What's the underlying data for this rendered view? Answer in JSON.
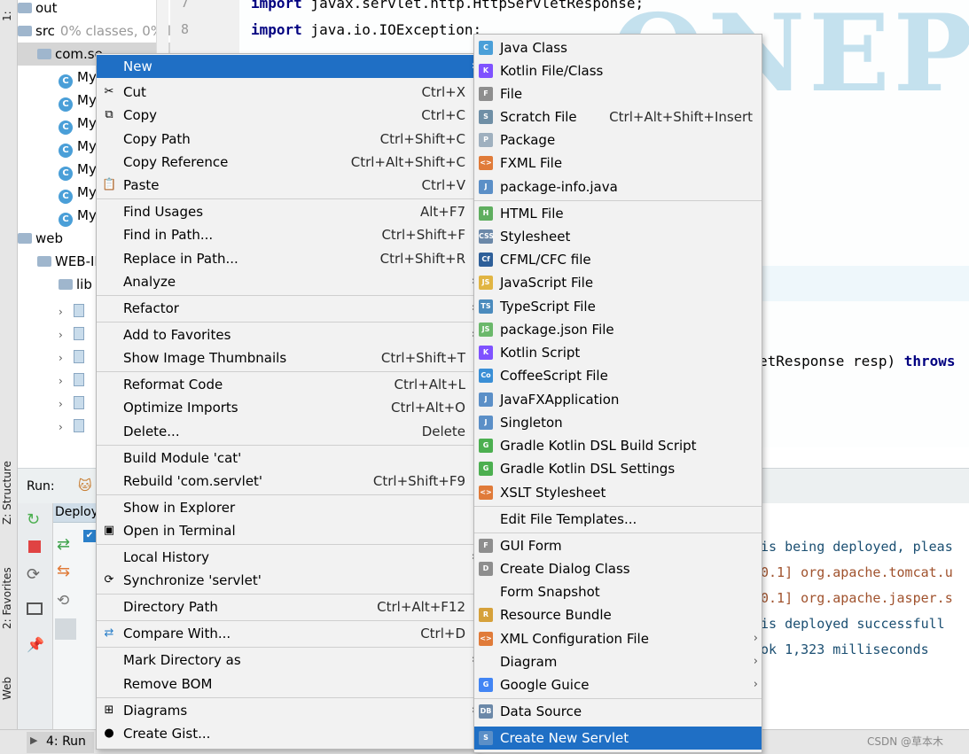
{
  "left_strip": {
    "project_tab": "1:",
    "structure_tab": "Z: Structure",
    "favorites_tab": "2: Favorites",
    "web_tab": "Web"
  },
  "tree": {
    "rows": [
      {
        "label": "out",
        "kind": "folder"
      },
      {
        "label": "src",
        "extra": "0% classes, 0% lir",
        "kind": "folder"
      },
      {
        "label": "com.se",
        "extra": "",
        "kind": "package"
      },
      {
        "label": "My",
        "kind": "class"
      },
      {
        "label": "My",
        "kind": "class"
      },
      {
        "label": "My",
        "kind": "class"
      },
      {
        "label": "My",
        "kind": "class"
      },
      {
        "label": "My",
        "kind": "class"
      },
      {
        "label": "My",
        "kind": "class"
      },
      {
        "label": "My",
        "kind": "class"
      },
      {
        "label": "web",
        "kind": "folder"
      },
      {
        "label": "WEB-IN",
        "kind": "folder"
      },
      {
        "label": "lib",
        "kind": "folder"
      }
    ],
    "class_badge": "C"
  },
  "editor": {
    "line_numbers": [
      "7",
      "8"
    ],
    "lines": [
      {
        "kw": "import",
        "rest": " javax.servlet.http.HttpServletResponse;"
      },
      {
        "kw": "import",
        "rest": " java.io.IOException;"
      }
    ],
    "fragment_rest": "etResponse resp) ",
    "fragment_kw": "throws",
    "watermark": "ONEPIECE"
  },
  "run_panel": {
    "run_label": "Run:",
    "deploy_tab": "Deploy",
    "console_lines": [
      {
        "text": "is being deployed, pleas",
        "style": "plain"
      },
      {
        "text": "0.1] org.apache.tomcat.u",
        "style": "orange"
      },
      {
        "text": "0.1] org.apache.jasper.s",
        "style": "orange"
      },
      {
        "text": "is deployed successfull",
        "style": "plain"
      },
      {
        "text": "ok 1,323 milliseconds",
        "style": "plain"
      }
    ]
  },
  "bottom_bar": {
    "run_tab": "4: Run",
    "credit": "CSDN @草本木"
  },
  "context_menu": {
    "items": [
      {
        "label": "New",
        "shortcut": "",
        "icon": "",
        "submenu": true,
        "highlight": true
      },
      {
        "label": "Cut",
        "shortcut": "Ctrl+X",
        "icon": "scissors-icon",
        "submenu": false
      },
      {
        "label": "Copy",
        "shortcut": "Ctrl+C",
        "icon": "copy-icon",
        "submenu": false
      },
      {
        "label": "Copy Path",
        "shortcut": "Ctrl+Shift+C",
        "icon": "",
        "submenu": false
      },
      {
        "label": "Copy Reference",
        "shortcut": "Ctrl+Alt+Shift+C",
        "icon": "",
        "submenu": false
      },
      {
        "label": "Paste",
        "shortcut": "Ctrl+V",
        "icon": "paste-icon",
        "submenu": false
      },
      {
        "label": "Find Usages",
        "shortcut": "Alt+F7",
        "icon": "",
        "submenu": false
      },
      {
        "label": "Find in Path...",
        "shortcut": "Ctrl+Shift+F",
        "icon": "",
        "submenu": false
      },
      {
        "label": "Replace in Path...",
        "shortcut": "Ctrl+Shift+R",
        "icon": "",
        "submenu": false
      },
      {
        "label": "Analyze",
        "shortcut": "",
        "icon": "",
        "submenu": true
      },
      {
        "label": "Refactor",
        "shortcut": "",
        "icon": "",
        "submenu": true
      },
      {
        "label": "Add to Favorites",
        "shortcut": "",
        "icon": "",
        "submenu": true
      },
      {
        "label": "Show Image Thumbnails",
        "shortcut": "Ctrl+Shift+T",
        "icon": "",
        "submenu": false
      },
      {
        "label": "Reformat Code",
        "shortcut": "Ctrl+Alt+L",
        "icon": "",
        "submenu": false
      },
      {
        "label": "Optimize Imports",
        "shortcut": "Ctrl+Alt+O",
        "icon": "",
        "submenu": false
      },
      {
        "label": "Delete...",
        "shortcut": "Delete",
        "icon": "",
        "submenu": false
      },
      {
        "label": "Build Module 'cat'",
        "shortcut": "",
        "icon": "",
        "submenu": false
      },
      {
        "label": "Rebuild 'com.servlet'",
        "shortcut": "Ctrl+Shift+F9",
        "icon": "",
        "submenu": false
      },
      {
        "label": "Show in Explorer",
        "shortcut": "",
        "icon": "",
        "submenu": false
      },
      {
        "label": "Open in Terminal",
        "shortcut": "",
        "icon": "terminal-icon",
        "submenu": false
      },
      {
        "label": "Local History",
        "shortcut": "",
        "icon": "",
        "submenu": true
      },
      {
        "label": "Synchronize 'servlet'",
        "shortcut": "",
        "icon": "sync-icon",
        "submenu": false
      },
      {
        "label": "Directory Path",
        "shortcut": "Ctrl+Alt+F12",
        "icon": "",
        "submenu": false
      },
      {
        "label": "Compare With...",
        "shortcut": "Ctrl+D",
        "icon": "compare-icon",
        "submenu": false
      },
      {
        "label": "Mark Directory as",
        "shortcut": "",
        "icon": "",
        "submenu": true
      },
      {
        "label": "Remove BOM",
        "shortcut": "",
        "icon": "",
        "submenu": false
      },
      {
        "label": "Diagrams",
        "shortcut": "",
        "icon": "diagram-icon",
        "submenu": true
      },
      {
        "label": "Create Gist...",
        "shortcut": "",
        "icon": "github-icon",
        "submenu": false
      }
    ]
  },
  "new_submenu": {
    "items": [
      {
        "label": "Java Class",
        "shortcut": "",
        "icon": "C",
        "color": "#4a9fd8",
        "submenu": false
      },
      {
        "label": "Kotlin File/Class",
        "shortcut": "",
        "icon": "K",
        "color": "#7f52ff",
        "submenu": false
      },
      {
        "label": "File",
        "shortcut": "",
        "icon": "F",
        "color": "#8e8e8e",
        "submenu": false
      },
      {
        "label": "Scratch File",
        "shortcut": "Ctrl+Alt+Shift+Insert",
        "icon": "S",
        "color": "#6f8fa6",
        "submenu": false
      },
      {
        "label": "Package",
        "shortcut": "",
        "icon": "P",
        "color": "#9fb0bf",
        "submenu": false
      },
      {
        "label": "FXML File",
        "shortcut": "",
        "icon": "<>",
        "color": "#e07b39",
        "submenu": false
      },
      {
        "label": "package-info.java",
        "shortcut": "",
        "icon": "J",
        "color": "#5b8fc7",
        "submenu": false
      },
      {
        "label": "HTML File",
        "shortcut": "",
        "icon": "H",
        "color": "#5fae5f",
        "submenu": false
      },
      {
        "label": "Stylesheet",
        "shortcut": "",
        "icon": "CSS",
        "color": "#6b88a8",
        "submenu": false
      },
      {
        "label": "CFML/CFC file",
        "shortcut": "",
        "icon": "Cf",
        "color": "#2e5f99",
        "submenu": false
      },
      {
        "label": "JavaScript File",
        "shortcut": "",
        "icon": "JS",
        "color": "#e1b543",
        "submenu": false
      },
      {
        "label": "TypeScript File",
        "shortcut": "",
        "icon": "TS",
        "color": "#4b8bbd",
        "submenu": false
      },
      {
        "label": "package.json File",
        "shortcut": "",
        "icon": "JS",
        "color": "#6bb86b",
        "submenu": false
      },
      {
        "label": "Kotlin Script",
        "shortcut": "",
        "icon": "K",
        "color": "#7f52ff",
        "submenu": false
      },
      {
        "label": "CoffeeScript File",
        "shortcut": "",
        "icon": "Co",
        "color": "#3a8fd6",
        "submenu": false
      },
      {
        "label": "JavaFXApplication",
        "shortcut": "",
        "icon": "J",
        "color": "#5b8fc7",
        "submenu": false
      },
      {
        "label": "Singleton",
        "shortcut": "",
        "icon": "J",
        "color": "#5b8fc7",
        "submenu": false
      },
      {
        "label": "Gradle Kotlin DSL Build Script",
        "shortcut": "",
        "icon": "G",
        "color": "#4caf50",
        "submenu": false
      },
      {
        "label": "Gradle Kotlin DSL Settings",
        "shortcut": "",
        "icon": "G",
        "color": "#4caf50",
        "submenu": false
      },
      {
        "label": "XSLT Stylesheet",
        "shortcut": "",
        "icon": "<>",
        "color": "#e07b39",
        "submenu": false
      },
      {
        "label": "Edit File Templates...",
        "shortcut": "",
        "icon": "",
        "color": "",
        "submenu": false
      },
      {
        "label": "GUI Form",
        "shortcut": "",
        "icon": "F",
        "color": "#8e8e8e",
        "submenu": false
      },
      {
        "label": "Create Dialog Class",
        "shortcut": "",
        "icon": "D",
        "color": "#8e8e8e",
        "submenu": false
      },
      {
        "label": "Form Snapshot",
        "shortcut": "",
        "icon": "",
        "color": "",
        "submenu": false
      },
      {
        "label": "Resource Bundle",
        "shortcut": "",
        "icon": "R",
        "color": "#d6a13a",
        "submenu": false
      },
      {
        "label": "XML Configuration File",
        "shortcut": "",
        "icon": "<>",
        "color": "#e07b39",
        "submenu": true
      },
      {
        "label": "Diagram",
        "shortcut": "",
        "icon": "",
        "color": "",
        "submenu": true
      },
      {
        "label": "Google Guice",
        "shortcut": "",
        "icon": "G",
        "color": "#4285f4",
        "submenu": true
      },
      {
        "label": "Data Source",
        "shortcut": "",
        "icon": "DB",
        "color": "#6b88a8",
        "submenu": false
      },
      {
        "label": "Create New Servlet",
        "shortcut": "",
        "icon": "S",
        "color": "#5b8fc7",
        "submenu": false,
        "highlight": true
      }
    ]
  },
  "colors": {
    "highlight": "#1f6fc5",
    "menu_bg": "#f2f2f2"
  }
}
